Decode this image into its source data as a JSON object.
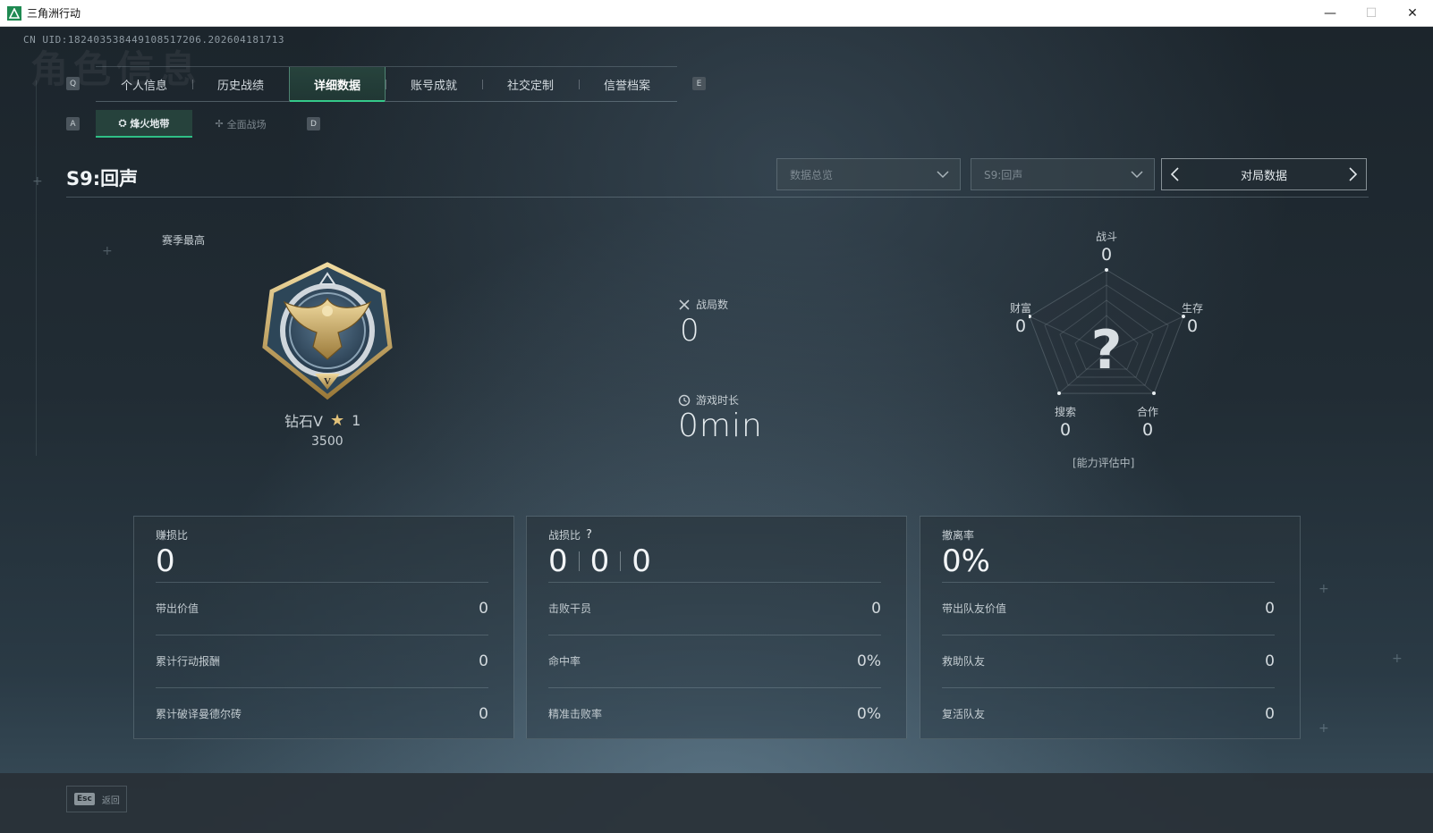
{
  "window": {
    "title": "三角洲行动",
    "minimize": "—",
    "maximize": "☐",
    "close": "✕"
  },
  "uid_text": "CN UID:18240353844910851720​6.202604181713",
  "ghost_title": "角色信息",
  "key_hints": {
    "tab_prev": "Q",
    "tab_next": "E",
    "sub_prev": "A",
    "sub_next": "D"
  },
  "tabs": [
    {
      "label": "个人信息"
    },
    {
      "label": "历史战绩"
    },
    {
      "label": "详细数据",
      "active": true
    },
    {
      "label": "账号成就"
    },
    {
      "label": "社交定制"
    },
    {
      "label": "信誉档案"
    }
  ],
  "subtabs": [
    {
      "label": "烽火地带",
      "active": true,
      "icon": "extraction-icon"
    },
    {
      "label": "全面战场",
      "icon": "battlefield-icon"
    }
  ],
  "season_title": "S9:回声",
  "dropdowns": {
    "overview": "数据总览",
    "season": "S9:回声"
  },
  "pager_label": "对局数据",
  "rank": {
    "season_best_label": "赛季最高",
    "tier": "钻石V",
    "stars": "1",
    "score": "3500"
  },
  "matches": {
    "label": "战局数",
    "value": "0"
  },
  "playtime": {
    "label": "游戏时长",
    "value": "0min"
  },
  "radar": {
    "labels": {
      "combat": "战斗",
      "survival": "生存",
      "teamwork": "合作",
      "search": "搜索",
      "wealth": "财富"
    },
    "values": {
      "combat": "0",
      "survival": "0",
      "teamwork": "0",
      "search": "0",
      "wealth": "0"
    },
    "unknown_mark": "?",
    "status": "[能力评估中]"
  },
  "cards": [
    {
      "title": "赚损比",
      "big": "0",
      "rows": [
        {
          "label": "带出价值",
          "value": "0"
        },
        {
          "label": "累计行动报酬",
          "value": "0"
        },
        {
          "label": "累计破译曼德尔砖",
          "value": "0"
        }
      ]
    },
    {
      "title": "战损比",
      "help": "?",
      "big_parts": [
        "0",
        "0",
        "0"
      ],
      "rows": [
        {
          "label": "击败干员",
          "value": "0"
        },
        {
          "label": "命中率",
          "value": "0%"
        },
        {
          "label": "精准击败率",
          "value": "0%"
        }
      ]
    },
    {
      "title": "撤离率",
      "big": "0%",
      "rows": [
        {
          "label": "带出队友价值",
          "value": "0"
        },
        {
          "label": "救助队友",
          "value": "0"
        },
        {
          "label": "复活队友",
          "value": "0"
        }
      ]
    }
  ],
  "footer": {
    "esc_key": "Esc",
    "back_label": "返回"
  },
  "colors": {
    "accent_green": "#35c98a",
    "gold": "#e2c27a",
    "title_bg": "#ffffff"
  }
}
